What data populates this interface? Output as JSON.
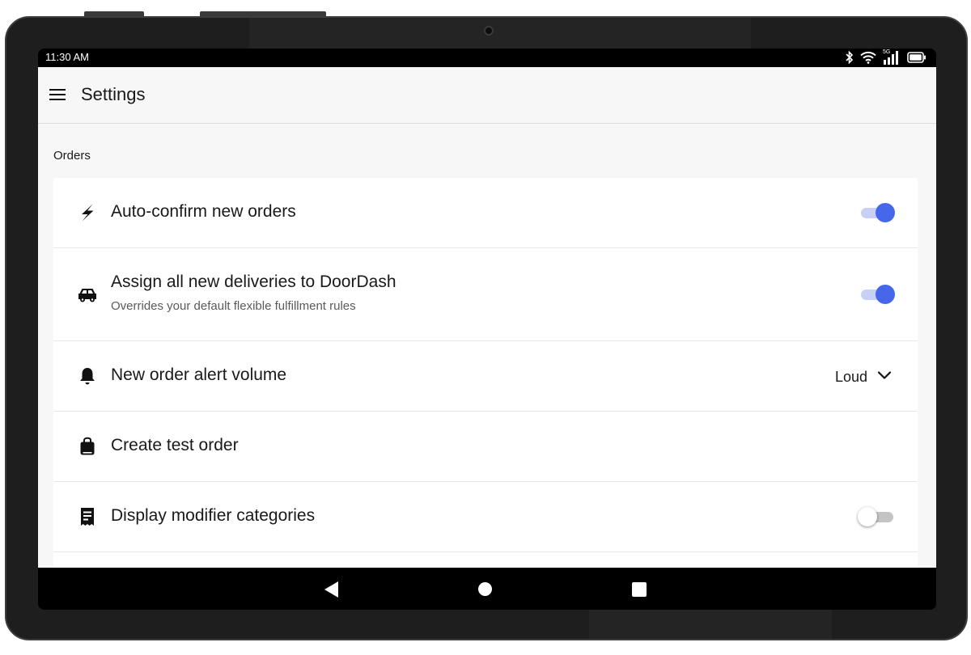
{
  "status_bar": {
    "time": "11:30 AM",
    "icons": [
      "bluetooth-icon",
      "wifi-icon",
      "5g-signal-icon",
      "battery-icon"
    ],
    "network_label": "5G"
  },
  "app_bar": {
    "title": "Settings",
    "menu_icon": "hamburger-menu-icon"
  },
  "section": {
    "label": "Orders"
  },
  "settings": [
    {
      "icon": "lightning-bolt-icon",
      "title": "Auto-confirm new orders",
      "control": "toggle",
      "enabled": true
    },
    {
      "icon": "car-icon",
      "title": "Assign all new deliveries to DoorDash",
      "subtitle": "Overrides your default flexible fulfillment rules",
      "control": "toggle",
      "enabled": true
    },
    {
      "icon": "bell-icon",
      "title": "New order alert volume",
      "control": "dropdown",
      "value": "Loud"
    },
    {
      "icon": "shopping-bag-icon",
      "title": "Create test order",
      "control": "none"
    },
    {
      "icon": "receipt-icon",
      "title": "Display modifier categories",
      "control": "toggle",
      "enabled": false
    }
  ],
  "nav_bar": {
    "buttons": [
      "back-icon",
      "home-icon",
      "recents-icon"
    ]
  },
  "colors": {
    "accent": "#4667e9",
    "accent_track": "#c9d0f5",
    "background": "#f7f7f7",
    "card": "#ffffff",
    "text": "#191919",
    "secondary_text": "#5a5a5a"
  }
}
